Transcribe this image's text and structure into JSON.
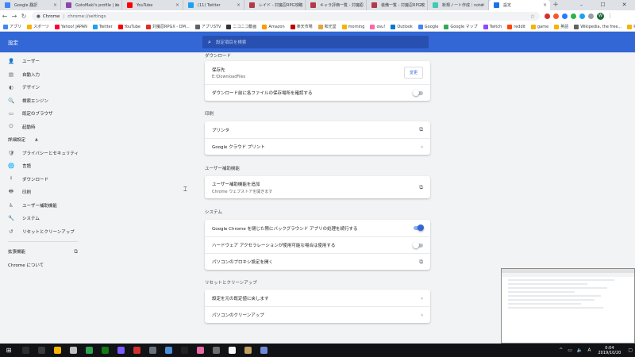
{
  "tabs": [
    {
      "title": "Google 翻訳",
      "color": "#4285f4"
    },
    {
      "title": "GotoMaki's profile | as",
      "color": "#8e44ad"
    },
    {
      "title": "YouTube",
      "color": "#ff0000"
    },
    {
      "title": "(11) Twitter",
      "color": "#1da1f2"
    },
    {
      "title": "レイド - 対魔忍RPG攻略",
      "color": "#b23a48"
    },
    {
      "title": "キャラ評価一覧 - 対魔忍",
      "color": "#b23a48"
    },
    {
      "title": "装備一覧 - 対魔忍RPG攻",
      "color": "#b23a48"
    },
    {
      "title": "新規ノート作成｜note",
      "color": "#41c9b4"
    },
    {
      "title": "設定",
      "color": "#1a73e8"
    }
  ],
  "window_controls": [
    "–",
    "☐",
    "✕"
  ],
  "toolbar": {
    "chrome_label": "Chrome",
    "url": "chrome://settings"
  },
  "bookmarks": [
    {
      "label": "アプリ",
      "color": "#4285f4"
    },
    {
      "label": "スポーツ",
      "color": "#f4b400"
    },
    {
      "label": "Yahoo! JAPAN",
      "color": "#ff0033"
    },
    {
      "label": "Twitter",
      "color": "#1da1f2"
    },
    {
      "label": "YouTube",
      "color": "#ff0000"
    },
    {
      "label": "対魔忍RPGX - DM...",
      "color": "#d93025"
    },
    {
      "label": "アプリSTV",
      "color": "#5f6368"
    },
    {
      "label": "ニコニコ動画",
      "color": "#333333"
    },
    {
      "label": "Amazon",
      "color": "#ff9900"
    },
    {
      "label": "楽天市場",
      "color": "#bf0000"
    },
    {
      "label": "和光堂",
      "color": "#e8a33d"
    },
    {
      "label": "morning",
      "color": "#f4b400"
    },
    {
      "label": "osu!",
      "color": "#ff66aa"
    },
    {
      "label": "Outlook",
      "color": "#0078d4"
    },
    {
      "label": "Google",
      "color": "#4285f4"
    },
    {
      "label": "Google マップ",
      "color": "#34a853"
    },
    {
      "label": "Twitch",
      "color": "#9146ff"
    },
    {
      "label": "reddit",
      "color": "#ff4500"
    },
    {
      "label": "game",
      "color": "#f4b400"
    },
    {
      "label": "英語",
      "color": "#f4b400"
    },
    {
      "label": "Wikipedia, the free...",
      "color": "#5f6368"
    },
    {
      "label": "P",
      "color": "#f4b400"
    }
  ],
  "settings_header": {
    "title": "設定",
    "search_placeholder": "設定項目を検索"
  },
  "sidebar": {
    "items": [
      {
        "label": "ユーザー",
        "icon": "👤"
      },
      {
        "label": "自動入力",
        "icon": "▤"
      },
      {
        "label": "デザイン",
        "icon": "◐"
      },
      {
        "label": "検索エンジン",
        "icon": "🔍"
      },
      {
        "label": "既定のブラウザ",
        "icon": "▭"
      },
      {
        "label": "起動時",
        "icon": "⏻"
      }
    ],
    "advanced_label": "詳細設定",
    "advanced_items": [
      {
        "label": "プライバシーとセキュリティ",
        "icon": "🛡"
      },
      {
        "label": "言語",
        "icon": "🌐"
      },
      {
        "label": "ダウンロード",
        "icon": "⭳"
      },
      {
        "label": "印刷",
        "icon": "🖶"
      },
      {
        "label": "ユーザー補助機能",
        "icon": "♿"
      },
      {
        "label": "システム",
        "icon": "🔧"
      },
      {
        "label": "リセットとクリーンアップ",
        "icon": "↺"
      }
    ],
    "extensions_label": "拡張機能",
    "about_label": "Chrome について"
  },
  "main": {
    "downloads_title": "ダウンロード",
    "save_location_label": "保存先",
    "save_location_value": "E:\\DownloadFiles",
    "change_button": "変更",
    "ask_location_label": "ダウンロード前に各ファイルの保存場所を確認する",
    "ask_location_on": false,
    "printing_title": "印刷",
    "printers_label": "プリンタ",
    "cloud_print_label": "Google クラウド プリント",
    "accessibility_title": "ユーザー補助機能",
    "add_accessibility_label": "ユーザー補助機能を追加",
    "add_accessibility_sub": "Chrome ウェブストアを開きます",
    "system_title": "システム",
    "background_apps_label": "Google Chrome を閉じた際にバックグラウンド アプリの処理を続行する",
    "background_apps_on": true,
    "hw_accel_label": "ハードウェア アクセラレーションが使用可能な場合は使用する",
    "hw_accel_on": false,
    "proxy_label": "パソコンのプロキシ設定を開く",
    "reset_title": "リセットとクリーンアップ",
    "restore_defaults_label": "設定を元の既定値に戻します",
    "cleanup_label": "パソコンのクリーンアップ"
  },
  "taskbar": {
    "apps": [
      "#2d2d2d",
      "#3a3a3a",
      "#f4b400",
      "#c0c0c0",
      "#2ea44f",
      "#107c10",
      "#7b5cff",
      "#d32f2f",
      "#6a737d",
      "#4a90d9",
      "#222222",
      "#e86aa6",
      "#6e6e6e",
      "#f8f8f8",
      "#c0a060",
      "#7289da"
    ],
    "time": "0:04",
    "date": "2019/10/20"
  }
}
